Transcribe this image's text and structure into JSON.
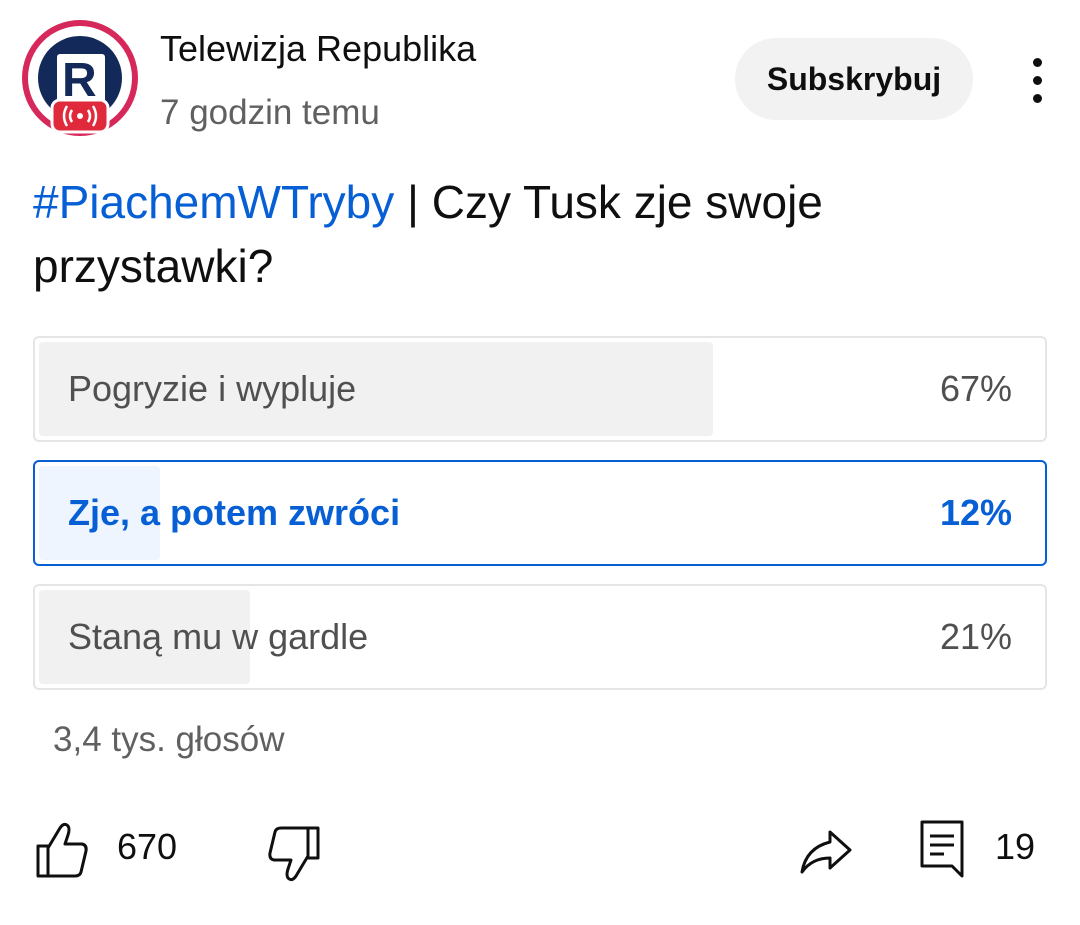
{
  "channel": {
    "name": "Telewizja Republika",
    "time": "7 godzin temu",
    "avatar_icon": "telewizja-republika-logo",
    "avatar_colors": {
      "ring": "#d6285a",
      "background": "#13295a",
      "badge": "#e0293a"
    }
  },
  "subscribe": {
    "label": "Subskrybuj"
  },
  "post": {
    "hashtag": "#PiachemWTryby",
    "text": " | Czy Tusk zje swoje przystawki?"
  },
  "poll": {
    "options": [
      {
        "label": "Pogryzie i wypluje",
        "percent": "67%",
        "fraction": 0.67,
        "selected": false
      },
      {
        "label": "Zje, a potem zwróci",
        "percent": "12%",
        "fraction": 0.12,
        "selected": true
      },
      {
        "label": "Staną mu w gardle",
        "percent": "21%",
        "fraction": 0.21,
        "selected": false
      }
    ],
    "votes": "3,4 tys. głosów"
  },
  "actions": {
    "like_count": "670",
    "comment_count": "19",
    "icons": [
      "thumbs-up-icon",
      "thumbs-down-icon",
      "share-icon",
      "comment-icon",
      "more-vert-icon"
    ]
  },
  "colors": {
    "accent": "#065fd4",
    "text": "#0f0f0f",
    "secondary": "#606060"
  }
}
